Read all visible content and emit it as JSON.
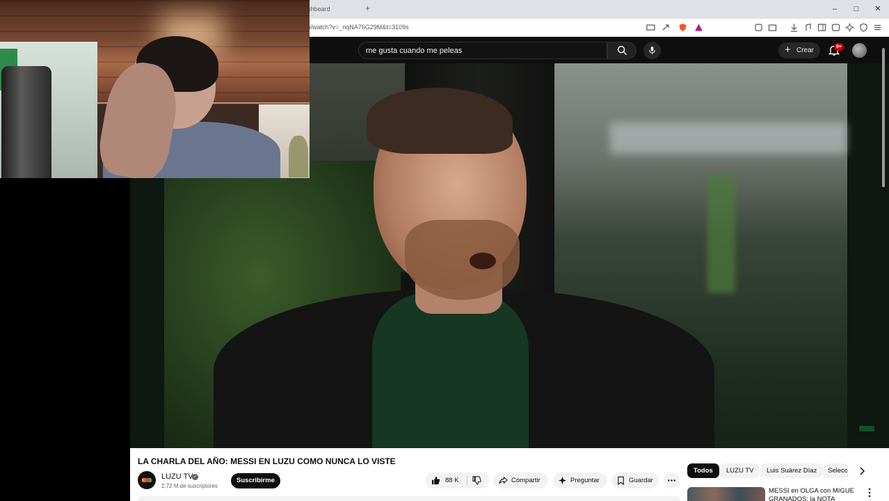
{
  "browser": {
    "tab_title": "shboard",
    "url": "m/watch?v=_nqNA76G29M&t=3109s",
    "window_controls": {
      "minimize": "–",
      "maximize": "□",
      "close": "✕"
    }
  },
  "youtube_header": {
    "search_query": "me gusta cuando me peleas",
    "create_label": "Crear",
    "notification_badge": "9+"
  },
  "video": {
    "title": "LA CHARLA DEL AÑO: MESSI EN LUZU COMO NUNCA LO VISTE"
  },
  "channel": {
    "name": "LUZU TV",
    "subscribers": "2,72 M de suscriptores",
    "subscribe_label": "Suscribirme",
    "verified_glyph": "✓"
  },
  "actions": {
    "likes": "88 K",
    "share_label": "Compartir",
    "ask_label": "Preguntar",
    "save_label": "Guardar"
  },
  "chips": [
    "Todos",
    "LUZU TV",
    "Luis Suárez Díaz",
    "Selecc"
  ],
  "recommendation": {
    "title": "MESSI en OLGA con MIGUE GRANADOS: la NOTA"
  },
  "colors": {
    "youtube_dark": "#0f0f0f",
    "notification_red": "#cc0000",
    "brave_orange": "#fb542b"
  },
  "icons": [
    "search-icon",
    "mic-icon",
    "bell-icon",
    "like-icon",
    "dislike-icon",
    "share-icon",
    "sparkle-icon",
    "bookmark-icon",
    "more-icon",
    "chevron-right-icon"
  ]
}
